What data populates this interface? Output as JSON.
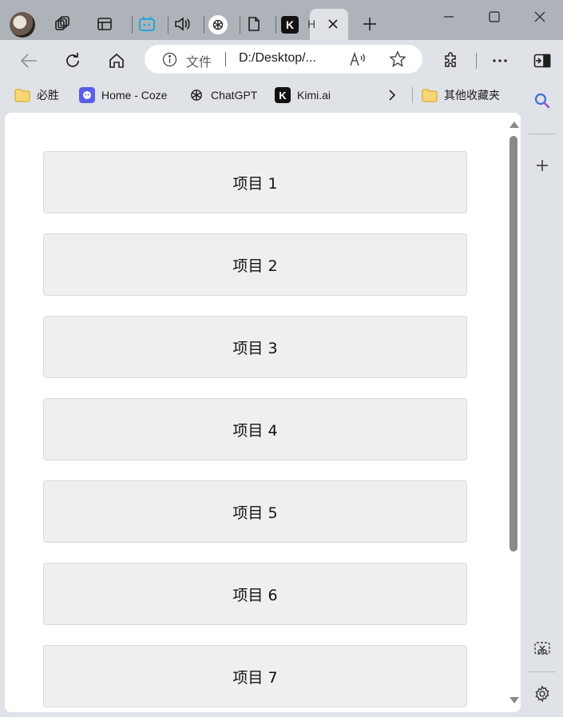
{
  "tabs": {
    "active_tab_label": "H"
  },
  "address_bar": {
    "security_label": "文件",
    "url": "D:/Desktop/..."
  },
  "bookmarks": [
    {
      "label": "必胜",
      "icon": "folder-icon"
    },
    {
      "label": "Home - Coze",
      "icon": "coze-icon"
    },
    {
      "label": "ChatGPT",
      "icon": "chatgpt-icon"
    },
    {
      "label": "Kimi.ai",
      "icon": "kimi-icon"
    }
  ],
  "bookmarks_other": {
    "label": "其他收藏夹",
    "icon": "folder-icon"
  },
  "items": [
    "项目 1",
    "项目 2",
    "项目 3",
    "项目 4",
    "项目 5",
    "项目 6",
    "项目 7"
  ],
  "colors": {
    "frame": "#aeb3b9",
    "toolbar": "#dfe2e6",
    "item_bg": "#efefef",
    "folder": "#f5c842",
    "coze": "#5b5ce8",
    "scroll_thumb": "#8a8a8a"
  }
}
